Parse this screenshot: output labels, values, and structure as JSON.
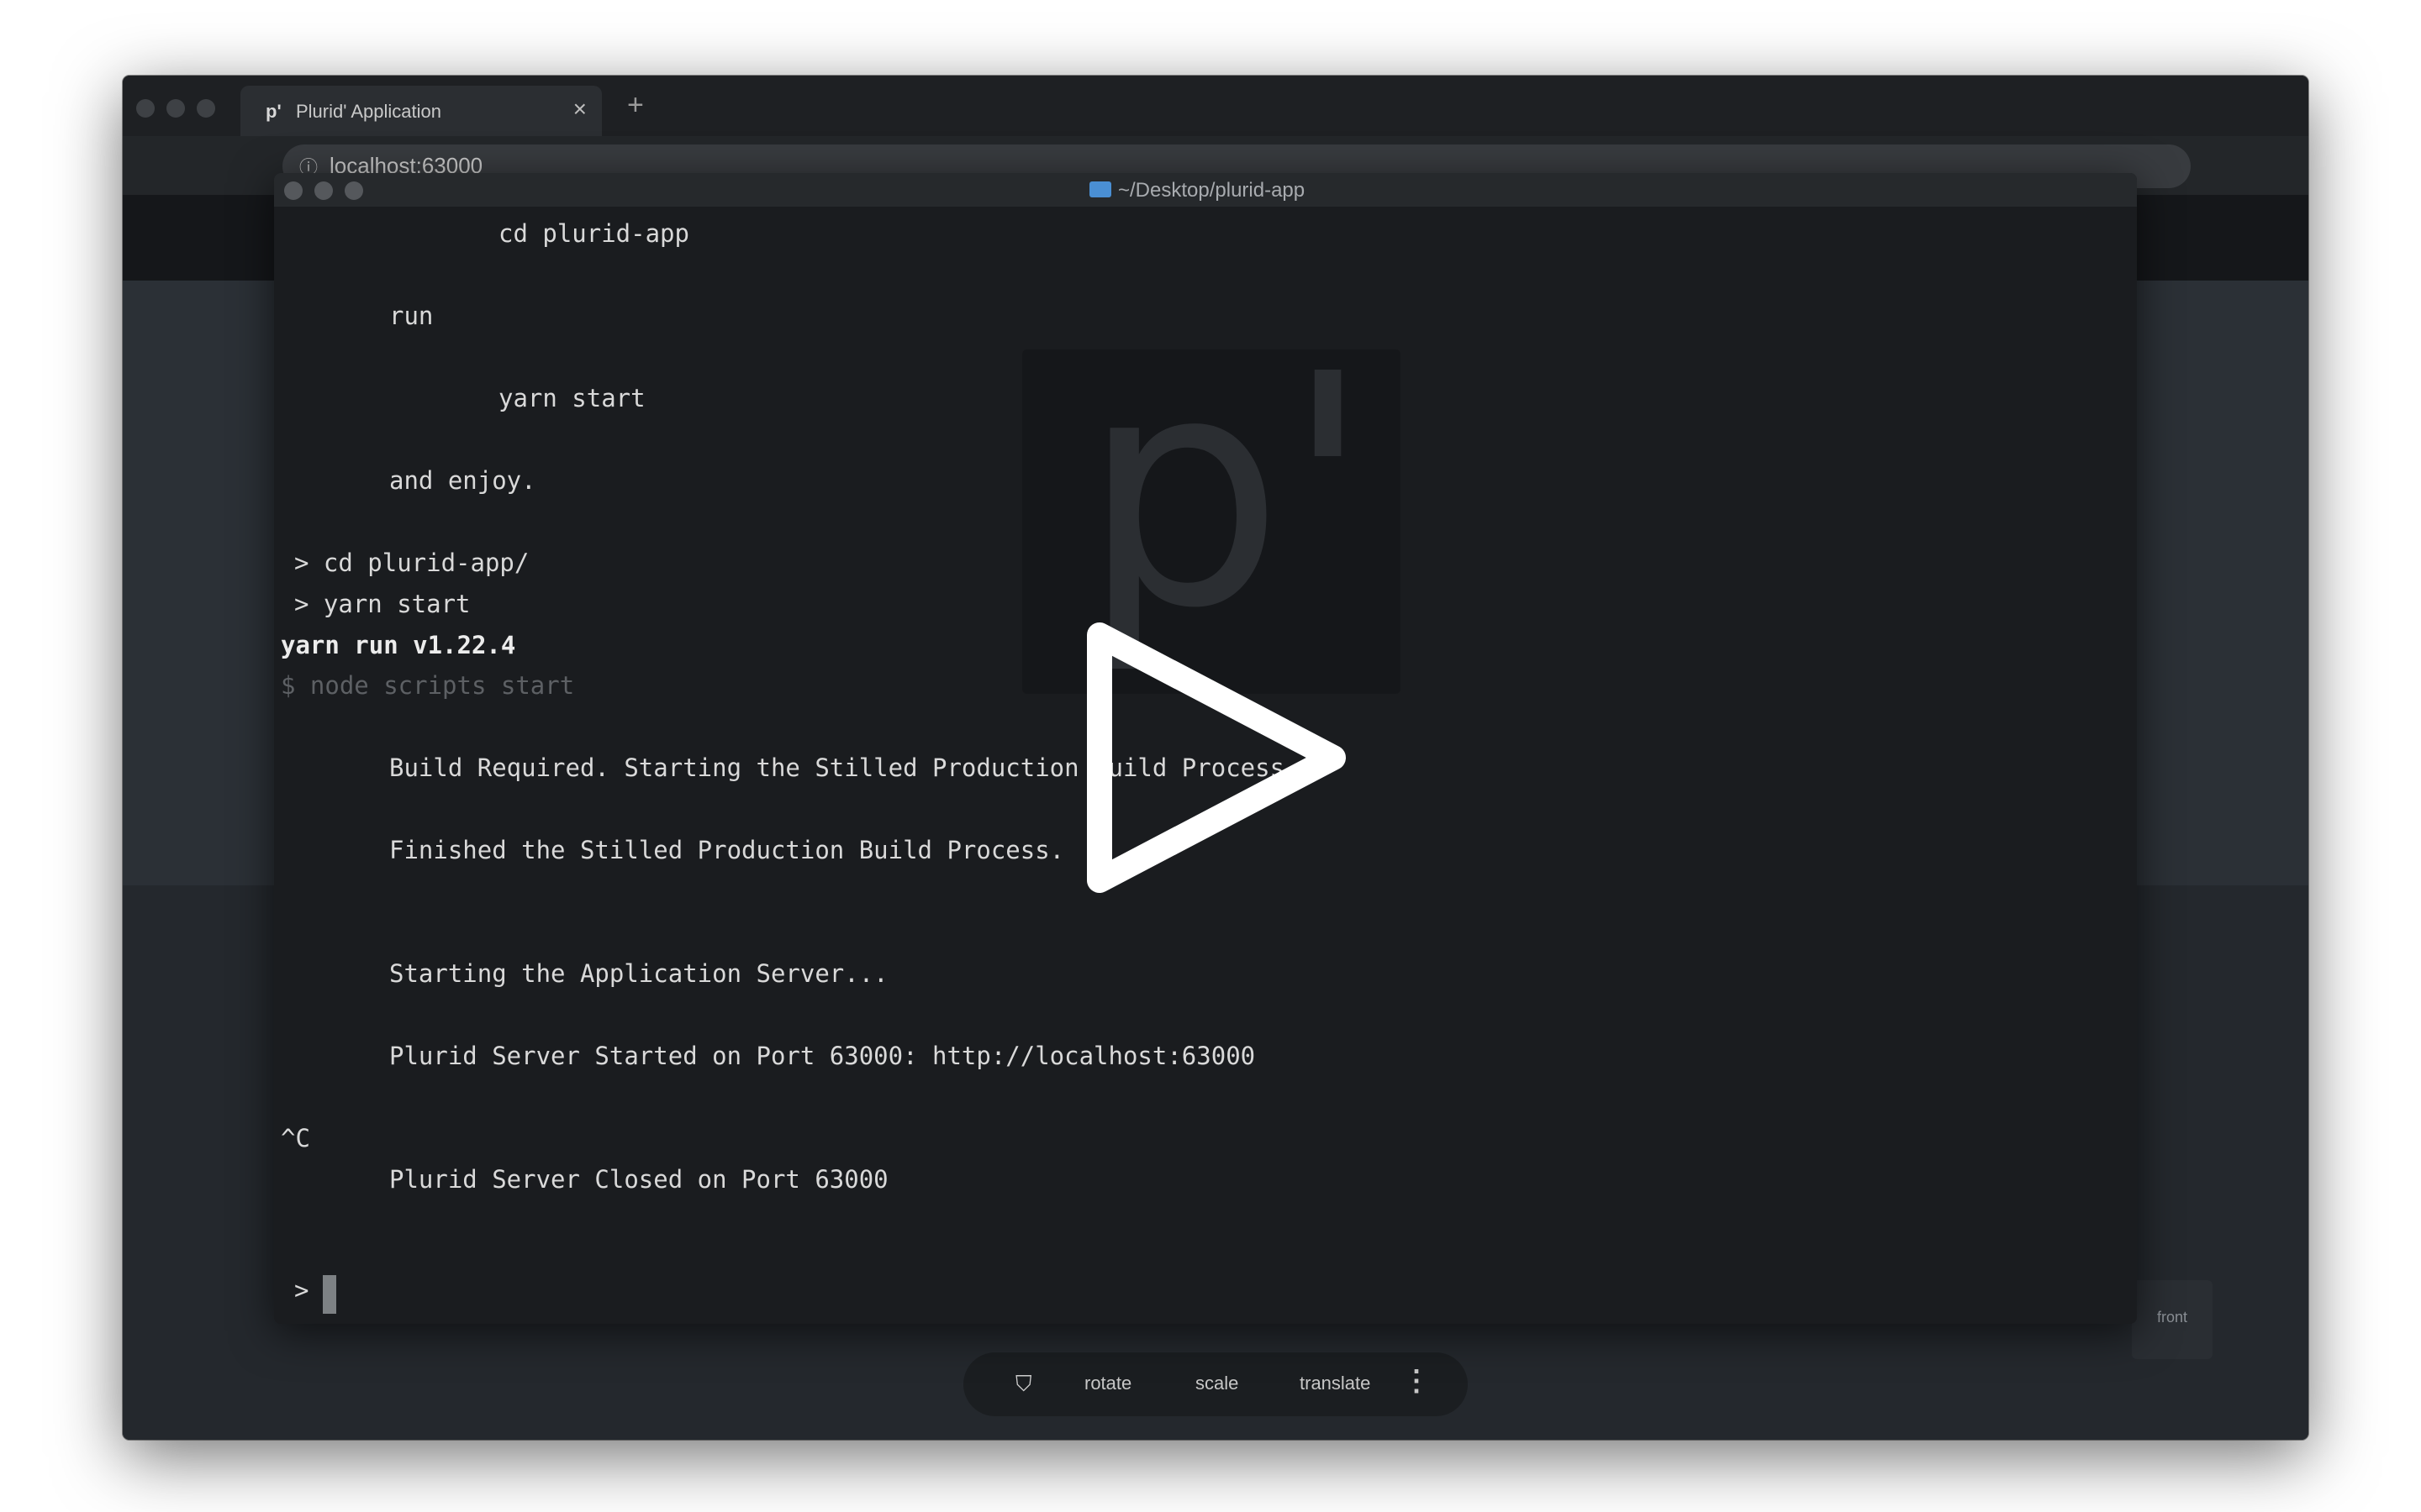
{
  "browser": {
    "tab": {
      "favicon": "p'",
      "title": "Plurid' Application",
      "close": "×"
    },
    "new_tab": "+",
    "url": {
      "info_icon": "ⓘ",
      "text": "localhost:63000"
    }
  },
  "terminal": {
    "title": "~/Desktop/plurid-app",
    "lines": {
      "l1": "cd plurid-app",
      "l2": "run",
      "l3": "yarn start",
      "l4": "and enjoy.",
      "l5": "> cd plurid-app/",
      "l6": "> yarn start",
      "l7": "yarn run v1.22.4",
      "l8": "$ node scripts start",
      "l9": "Build Required. Starting the Stilled Production Build Process...",
      "l10": "Finished the Stilled Production Build Process.",
      "l11": "Starting the Application Server...",
      "l12": "Plurid Server Started on Port 63000: http://localhost:63000",
      "l13": "^C",
      "l14": "Plurid Server Closed on Port 63000",
      "prompt": ">"
    },
    "logo_text": "p'"
  },
  "toolbar": {
    "rotate": "rotate",
    "scale": "scale",
    "translate": "translate",
    "more": "⋮",
    "shield": "⛉"
  },
  "front_button": {
    "label": "front"
  },
  "icons": {
    "play": "play-icon",
    "folder": "folder-icon",
    "shield": "shield-icon",
    "more": "more-vertical-icon",
    "close": "close-icon",
    "info": "info-icon"
  },
  "colors": {
    "terminal_bg": "#1a1c1f",
    "app_bg": "#2b3036",
    "folder_icon": "#4a8fd4",
    "play_icon": "#ffffff"
  }
}
